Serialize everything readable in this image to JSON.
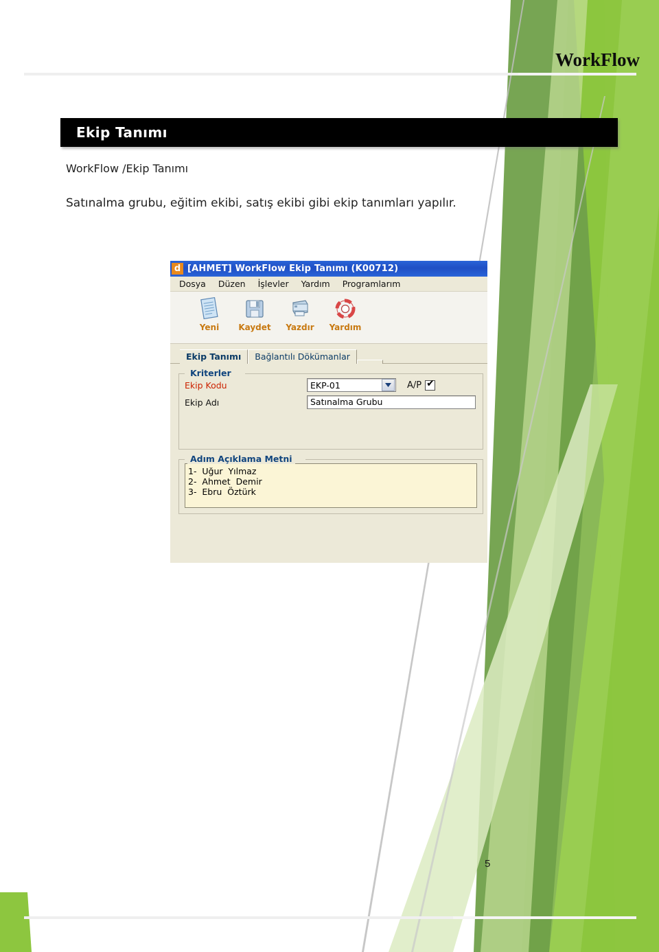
{
  "document": {
    "header_title": "WorkFlow",
    "page_number": "5",
    "banner_title": "Ekip Tanımı",
    "breadcrumb": "WorkFlow /Ekip Tanımı",
    "intro": "Satınalma grubu, eğitim ekibi, satış ekibi gibi ekip tanımları yapılır."
  },
  "colors": {
    "accent_bright_green": "#8DC63F",
    "accent_mid_green": "#76A64A",
    "accent_pale_green": "#D8E8B6",
    "accent_light_green": "#C2DE96",
    "banner_black": "#000000",
    "rule_gray": "#EFEFEF",
    "app_titlebar_blue": "#2A64D8",
    "app_face": "#ECE9D8",
    "required_red": "#CC2200",
    "legend_blue": "#11457E",
    "toolbar_label_orange": "#C87A12",
    "notes_yellow": "#FBF5D6"
  },
  "app": {
    "logo_letter": "d",
    "title": "[AHMET] WorkFlow Ekip Tanımı (K00712)",
    "menu": [
      {
        "label": "Dosya"
      },
      {
        "label": "Düzen"
      },
      {
        "label": "İşlevler"
      },
      {
        "label": "Yardım"
      },
      {
        "label": "Programlarım"
      }
    ],
    "toolbar": [
      {
        "label": "Yeni",
        "icon": "new-document-icon"
      },
      {
        "label": "Kaydet",
        "icon": "floppy-disk-save-icon"
      },
      {
        "label": "Yazdır",
        "icon": "printer-icon"
      },
      {
        "label": "Yardım",
        "icon": "life-ring-help-icon"
      }
    ],
    "tabs": [
      {
        "label": "Ekip Tanımı",
        "active": true
      },
      {
        "label": "Bağlantılı Dökümanlar",
        "active": false
      }
    ],
    "criteria": {
      "legend": "Kriterler",
      "ekip_kodu_label": "Ekip Kodu",
      "ekip_kodu_value": "EKP-01",
      "ap_label": "A/P",
      "ap_checked": "✔",
      "ekip_adi_label": "Ekip Adı",
      "ekip_adi_value": "Satınalma  Grubu"
    },
    "steps": {
      "legend": "Adım Açıklama Metni",
      "lines": [
        "1-  Uğur  Yılmaz",
        "2-  Ahmet  Demir",
        "3-  Ebru  Öztürk"
      ]
    }
  }
}
